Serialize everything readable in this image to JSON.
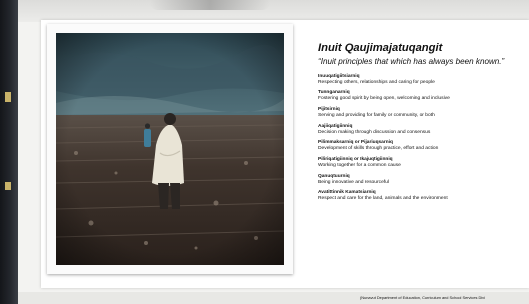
{
  "slide": {
    "title": "Inuit Qaujimajatuqangit",
    "subtitle": "“Inuit principles that which has always been known.”",
    "principles": [
      {
        "name": "Inuuqatigiitsiarniq",
        "description": "Respecting others, relationships and caring for people"
      },
      {
        "name": "Tunnganarniq",
        "description": "Fostering good spirit by being open, welcoming and inclusive"
      },
      {
        "name": "Pijitsirniq",
        "description": "Serving and providing for family or community, or both"
      },
      {
        "name": "Aajiiqatigiinniq",
        "description": "Decision making through discussion and consensus"
      },
      {
        "name": "Pilimmaksarniq or Pijariuqsarniq",
        "description": "Development of skills through practice, effort and action"
      },
      {
        "name": "Piliriqatigiinniq or Ikajuqtigiinniq",
        "description": "Working together for a common cause"
      },
      {
        "name": "Qanuqtuurniq",
        "description": "Being innovative and resourceful"
      },
      {
        "name": "Avatittinnik Kamatsiarniq",
        "description": "Respect and care for the land, animals and the environment"
      }
    ],
    "credit": "(Nunavut Department of Education, Curriculum and School Services Divi"
  },
  "photo": {
    "description_icon": "tundra-figure-photo"
  },
  "colors": {
    "sky": "#4c6a74",
    "ground": "#3d3028",
    "cloak": "#e9e4d6",
    "accent_stripe": "#c9b36a"
  }
}
